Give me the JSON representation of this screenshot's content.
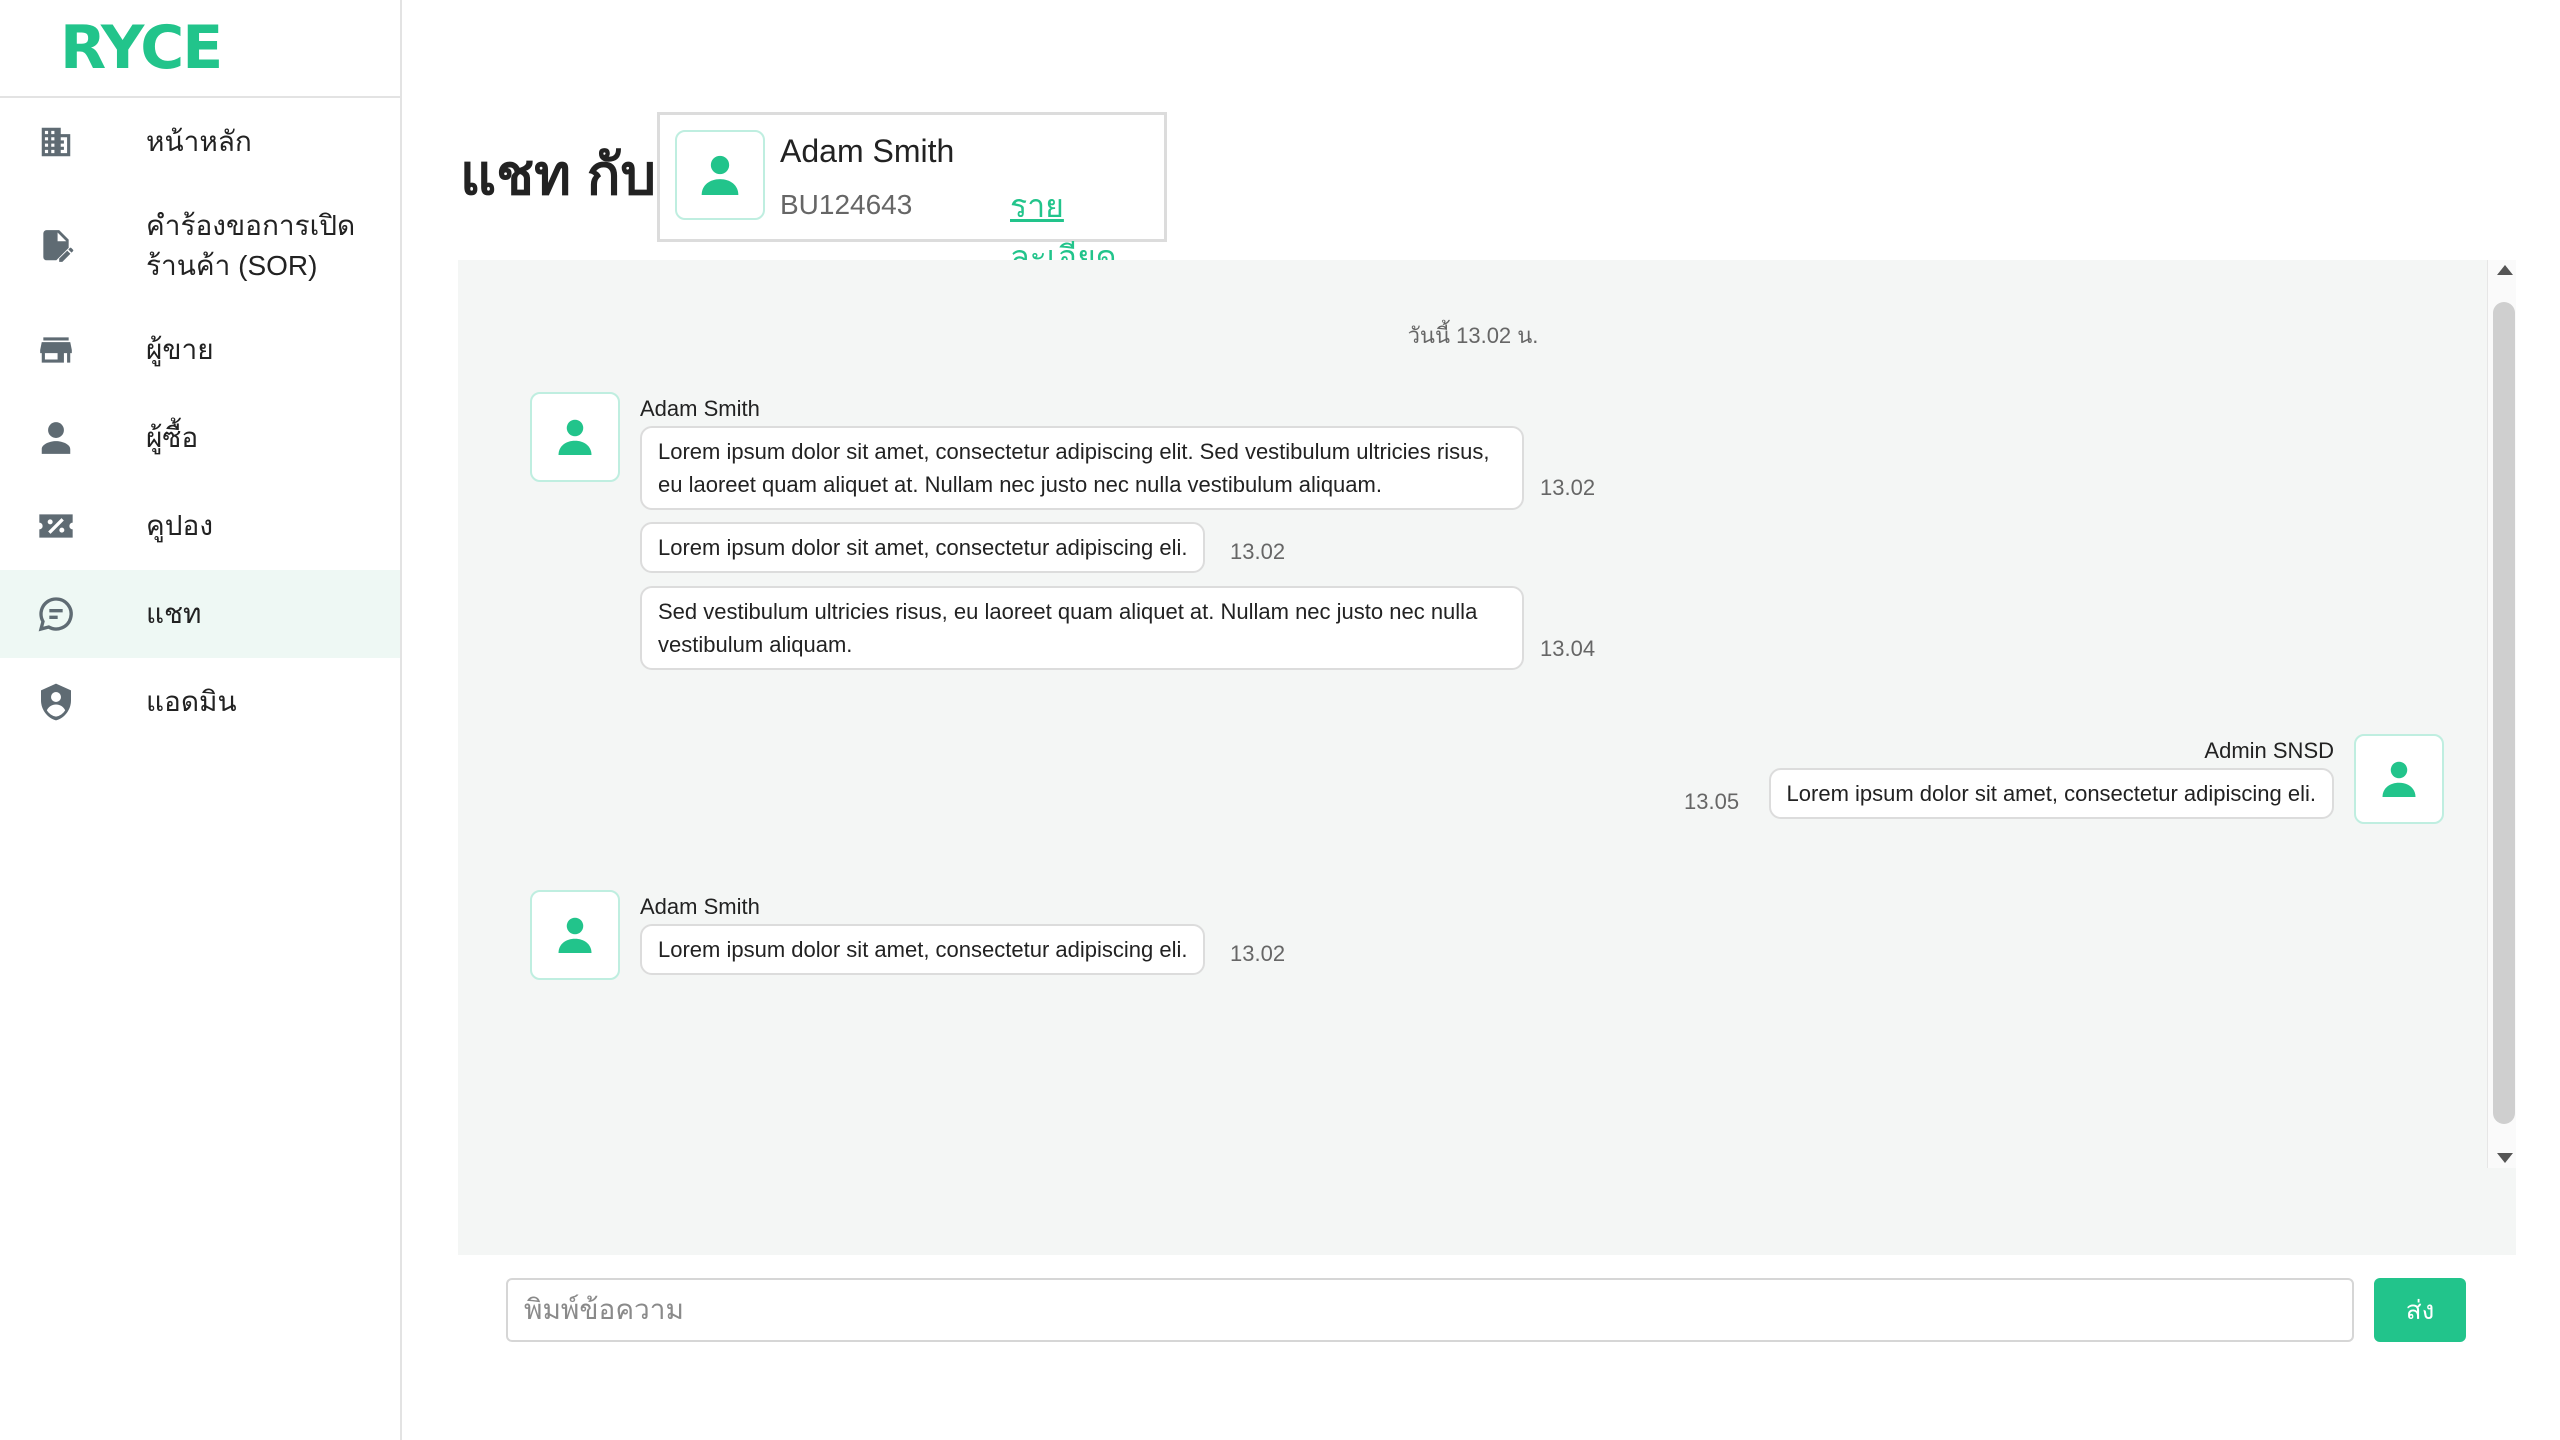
{
  "brand": {
    "logo_text": "RYCE",
    "accent_color": "#22c48b"
  },
  "sidebar": {
    "items": [
      {
        "label": "หน้าหลัก",
        "icon": "building-icon"
      },
      {
        "label": "คำร้องขอการเปิดร้านค้า (SOR)",
        "icon": "document-edit-icon"
      },
      {
        "label": "ผู้ขาย",
        "icon": "store-icon"
      },
      {
        "label": "ผู้ซื้อ",
        "icon": "person-icon"
      },
      {
        "label": "คูปอง",
        "icon": "coupon-icon"
      },
      {
        "label": "แชท",
        "icon": "chat-bubble-icon",
        "active": true
      },
      {
        "label": "แอดมิน",
        "icon": "shield-user-icon"
      }
    ]
  },
  "header": {
    "title": "แชท กับ",
    "contact": {
      "name": "Adam Smith",
      "id": "BU124643",
      "detail_link": "รายละเอียด"
    }
  },
  "chat": {
    "date_separator": "วันนี้ 13.02 น.",
    "groups": [
      {
        "sender": "Adam Smith",
        "side": "left",
        "messages": [
          {
            "text": "Lorem ipsum dolor sit amet, consectetur adipiscing elit. Sed vestibulum ultricies risus, eu laoreet quam aliquet at. Nullam nec justo nec nulla vestibulum aliquam.",
            "time": "13.02"
          },
          {
            "text": "Lorem ipsum dolor sit amet, consectetur adipiscing eli.",
            "time": "13.02"
          },
          {
            "text": "Sed vestibulum ultricies risus, eu laoreet quam aliquet at. Nullam nec justo nec nulla vestibulum aliquam.",
            "time": "13.04"
          }
        ]
      },
      {
        "sender": "Admin SNSD",
        "side": "right",
        "messages": [
          {
            "text": "Lorem ipsum dolor sit amet, consectetur adipiscing eli.",
            "time": "13.05"
          }
        ]
      },
      {
        "sender": "Adam Smith",
        "side": "left",
        "messages": [
          {
            "text": "Lorem ipsum dolor sit amet, consectetur adipiscing eli.",
            "time": "13.02"
          }
        ]
      }
    ]
  },
  "composer": {
    "placeholder": "พิมพ์ข้อความ",
    "value": "",
    "send_label": "ส่ง"
  }
}
